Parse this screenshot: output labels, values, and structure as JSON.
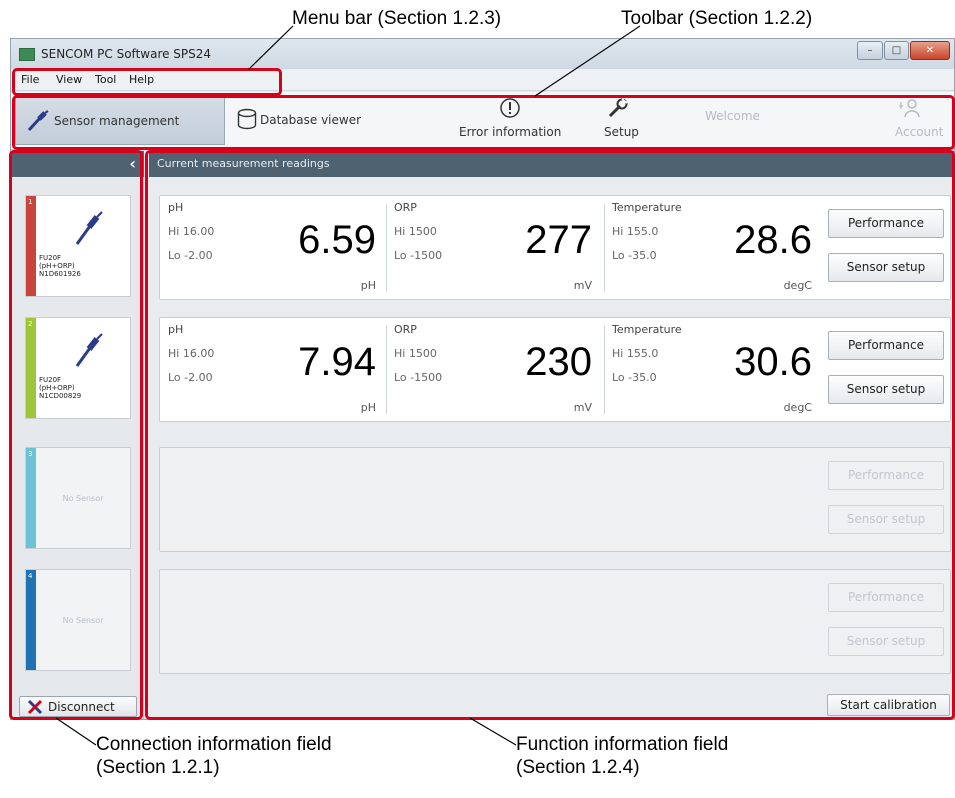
{
  "callouts": {
    "menu_bar": "Menu bar (Section 1.2.3)",
    "toolbar": "Toolbar (Section 1.2.2)",
    "connection_line1": "Connection information field",
    "connection_line2": "(Section 1.2.1)",
    "function_line1": "Function information field",
    "function_line2": "(Section 1.2.4)"
  },
  "window": {
    "title": "SENCOM PC Software SPS24",
    "controls": [
      "minimize",
      "maximize",
      "close"
    ]
  },
  "menu": {
    "items": [
      "File",
      "View",
      "Tool",
      "Help"
    ]
  },
  "toolbar": {
    "sensor_management": "Sensor management",
    "database_viewer": "Database viewer",
    "error_information": "Error information",
    "setup": "Setup",
    "welcome": "Welcome",
    "account": "Account"
  },
  "sensors": [
    {
      "number": "1",
      "color": "#c8453c",
      "model_lines": "FU20F\n(pH+ORP)\nN1D601926"
    },
    {
      "number": "2",
      "color": "#9ec43a",
      "model_lines": "FU20F\n(pH+ORP)\nN1CD00829"
    },
    {
      "number": "3",
      "color": "#6cc2d6",
      "empty_text": "No Sensor"
    },
    {
      "number": "4",
      "color": "#1f73b4",
      "empty_text": "No Sensor"
    }
  ],
  "disconnect_label": "Disconnect",
  "main": {
    "header": "Current measurement readings",
    "cards": [
      {
        "ph": {
          "title": "pH",
          "hi": "Hi 16.00",
          "lo": "Lo -2.00",
          "value": "6.59",
          "unit": "pH"
        },
        "orp": {
          "title": "ORP",
          "hi": "Hi  1500",
          "lo": "Lo -1500",
          "value": "277",
          "unit": "mV"
        },
        "temp": {
          "title": "Temperature",
          "hi": "Hi 155.0",
          "lo": "Lo -35.0",
          "value": "28.6",
          "unit": "degC"
        }
      },
      {
        "ph": {
          "title": "pH",
          "hi": "Hi 16.00",
          "lo": "Lo -2.00",
          "value": "7.94",
          "unit": "pH"
        },
        "orp": {
          "title": "ORP",
          "hi": "Hi  1500",
          "lo": "Lo -1500",
          "value": "230",
          "unit": "mV"
        },
        "temp": {
          "title": "Temperature",
          "hi": "Hi 155.0",
          "lo": "Lo -35.0",
          "value": "30.6",
          "unit": "degC"
        }
      }
    ],
    "performance_label": "Performance",
    "sensor_setup_label": "Sensor setup",
    "start_calibration": "Start calibration"
  },
  "colors": {
    "highlight": "#d6001c",
    "header_bar": "#4e6272"
  }
}
